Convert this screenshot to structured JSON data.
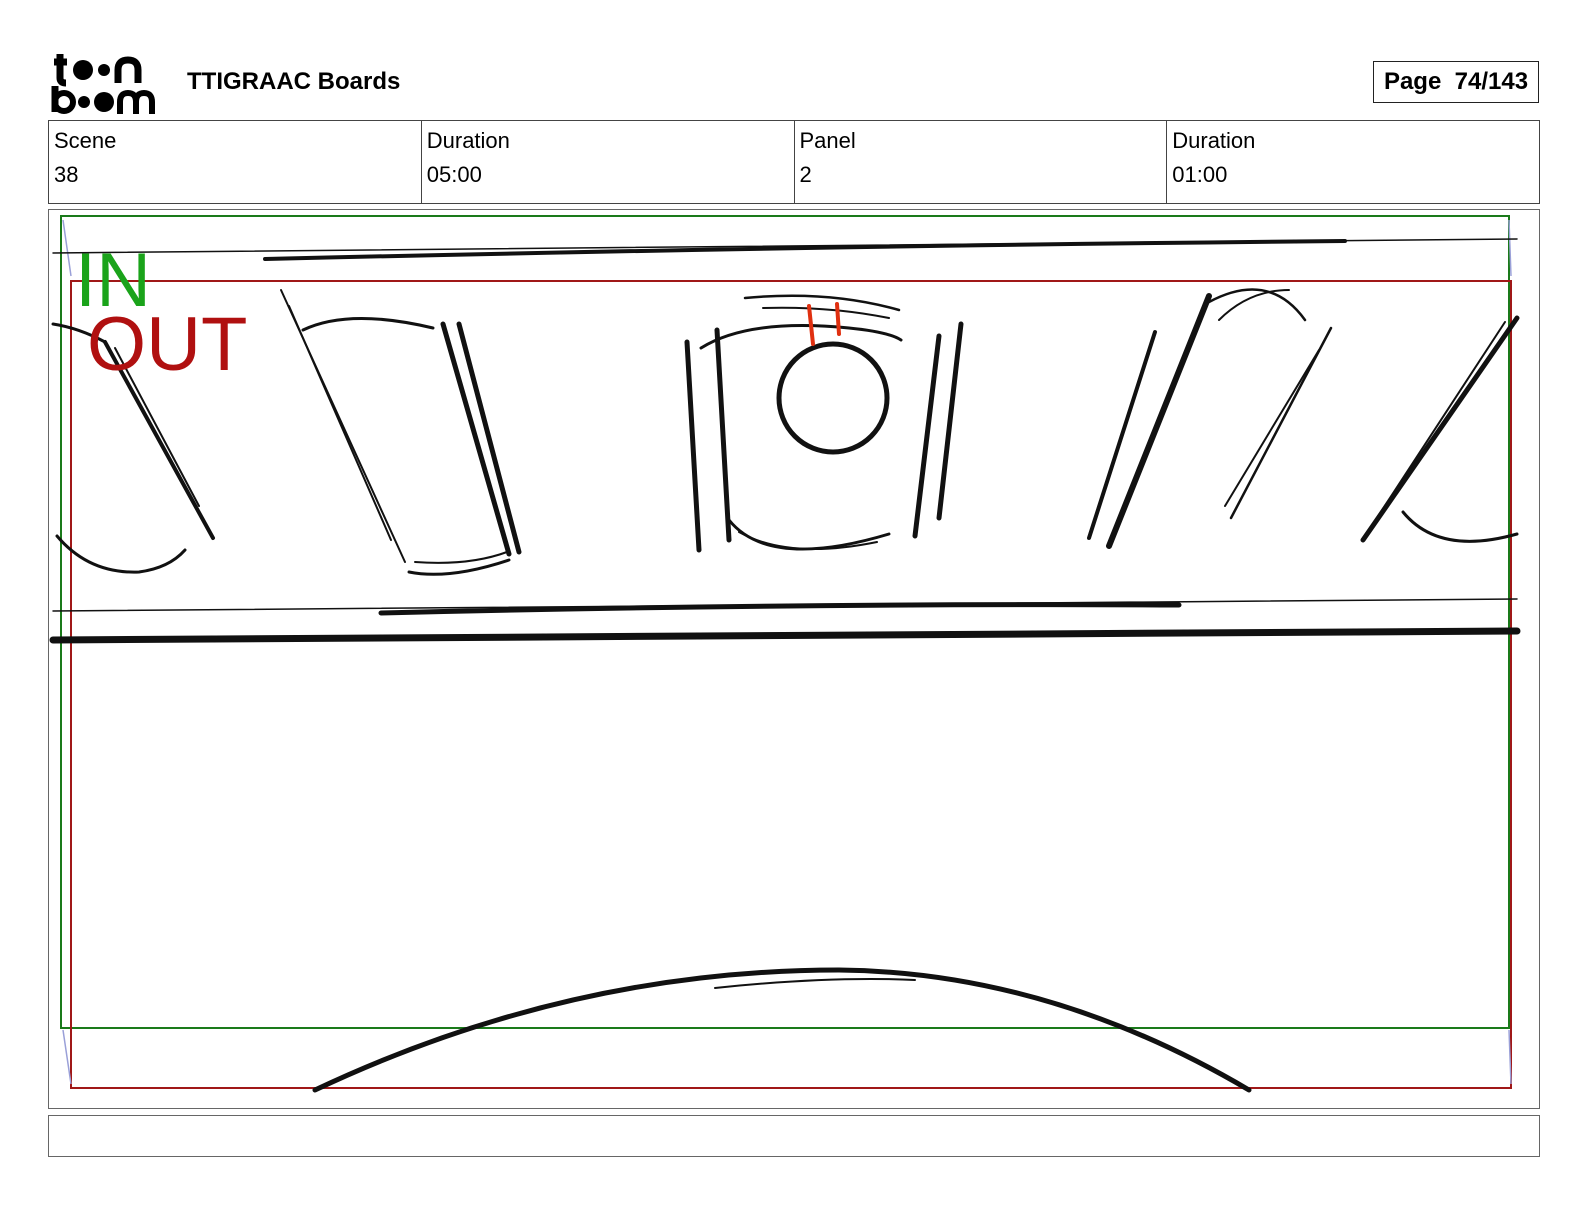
{
  "header": {
    "logo_text_top": "toon",
    "logo_text_bottom": "boom",
    "project_title": "TTIGRAAC Boards",
    "page_label": "Page",
    "page_value": "74/143"
  },
  "info": {
    "scene_label": "Scene",
    "scene_value": "38",
    "scene_duration_label": "Duration",
    "scene_duration_value": "05:00",
    "panel_label": "Panel",
    "panel_value": "2",
    "panel_duration_label": "Duration",
    "panel_duration_value": "01:00"
  },
  "panel": {
    "in_label": "IN",
    "out_label": "OUT",
    "in_frame_color": "#1a7a1a",
    "out_frame_color": "#a01818",
    "sketch_color": "#111111",
    "accent_color": "#e03010"
  },
  "caption": {
    "text": ""
  }
}
